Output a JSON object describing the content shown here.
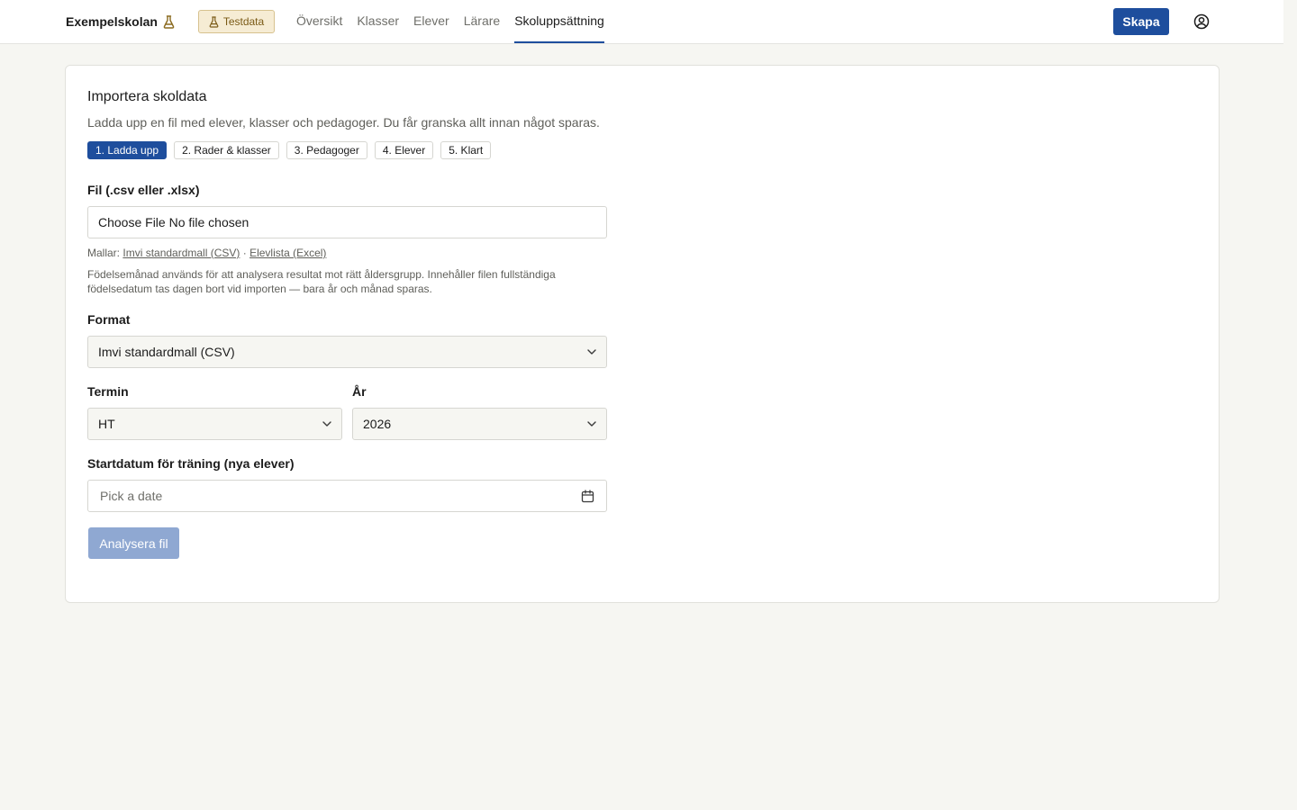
{
  "header": {
    "school_name": "Exempelskolan",
    "test_badge": "Testdata",
    "nav": [
      {
        "label": "Översikt",
        "active": false
      },
      {
        "label": "Klasser",
        "active": false
      },
      {
        "label": "Elever",
        "active": false
      },
      {
        "label": "Lärare",
        "active": false
      },
      {
        "label": "Skoluppsättning",
        "active": true
      }
    ],
    "create_button": "Skapa",
    "accent_color": "#1e4e9d"
  },
  "import": {
    "title": "Importera skoldata",
    "description": "Ladda upp en fil med elever, klasser och pedagoger. Du får granska allt innan något sparas.",
    "steps": [
      {
        "label": "1. Ladda upp",
        "active": true
      },
      {
        "label": "2. Rader & klasser",
        "active": false
      },
      {
        "label": "3. Pedagoger",
        "active": false
      },
      {
        "label": "4. Elever",
        "active": false
      },
      {
        "label": "5. Klart",
        "active": false
      }
    ],
    "file": {
      "label": "Fil (.csv eller .xlsx)",
      "value": "Choose File No file chosen"
    },
    "templates": {
      "prefix": "Mallar:",
      "link_csv": "Imvi standardmall (CSV)",
      "separator": "·",
      "link_excel": "Elevlista (Excel)"
    },
    "help_text": "Födelsemånad används för att analysera resultat mot rätt åldersgrupp. Innehåller filen fullständiga födelsedatum tas dagen bort vid importen — bara år och månad sparas.",
    "format": {
      "label": "Format",
      "value": "Imvi standardmall (CSV)"
    },
    "term": {
      "label": "Termin",
      "value": "HT"
    },
    "year": {
      "label": "År",
      "value": "2026"
    },
    "start_date": {
      "label": "Startdatum för träning (nya elever)",
      "placeholder": "Pick a date"
    },
    "analyze_button": "Analysera fil"
  }
}
